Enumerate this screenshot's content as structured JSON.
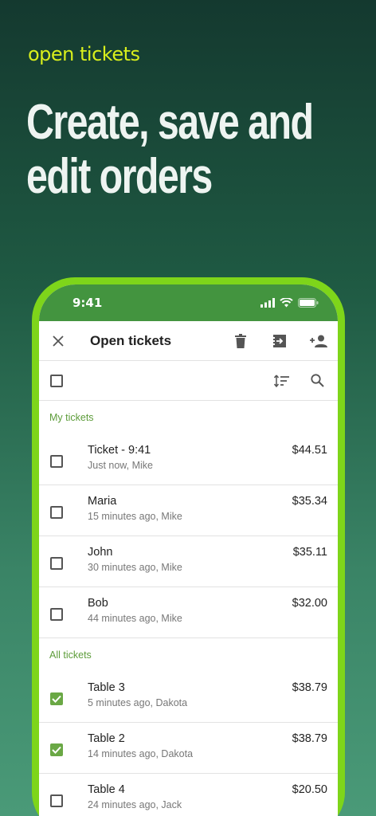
{
  "promo": {
    "tagline": "open tickets",
    "headline_line1": "Create, save and",
    "headline_line2": "edit orders"
  },
  "status_bar": {
    "time": "9:41"
  },
  "toolbar": {
    "title": "Open tickets",
    "icons": [
      "close-icon",
      "trash-icon",
      "move-ticket-icon",
      "assign-user-icon"
    ]
  },
  "subbar": {
    "icons": [
      "sort-icon",
      "search-icon"
    ]
  },
  "sections": [
    {
      "title": "My tickets",
      "items": [
        {
          "name": "Ticket - 9:41",
          "meta": "Just now, Mike",
          "price": "$44.51",
          "checked": false
        },
        {
          "name": "Maria",
          "meta": "15 minutes ago, Mike",
          "price": "$35.34",
          "checked": false
        },
        {
          "name": "John",
          "meta": "30 minutes ago, Mike",
          "price": "$35.11",
          "checked": false
        },
        {
          "name": "Bob",
          "meta": "44 minutes ago, Mike",
          "price": "$32.00",
          "checked": false
        }
      ]
    },
    {
      "title": "All tickets",
      "items": [
        {
          "name": "Table 3",
          "meta": "5 minutes ago, Dakota",
          "price": "$38.79",
          "checked": true
        },
        {
          "name": "Table 2",
          "meta": "14 minutes ago, Dakota",
          "price": "$38.79",
          "checked": true
        },
        {
          "name": "Table 4",
          "meta": "24 minutes ago, Jack",
          "price": "$20.50",
          "checked": false
        }
      ]
    }
  ],
  "colors": {
    "accent_green": "#43943f",
    "frame_lime": "#7ed51a",
    "tagline_yellow": "#d8ef1c",
    "checkbox_green": "#6aa845"
  }
}
